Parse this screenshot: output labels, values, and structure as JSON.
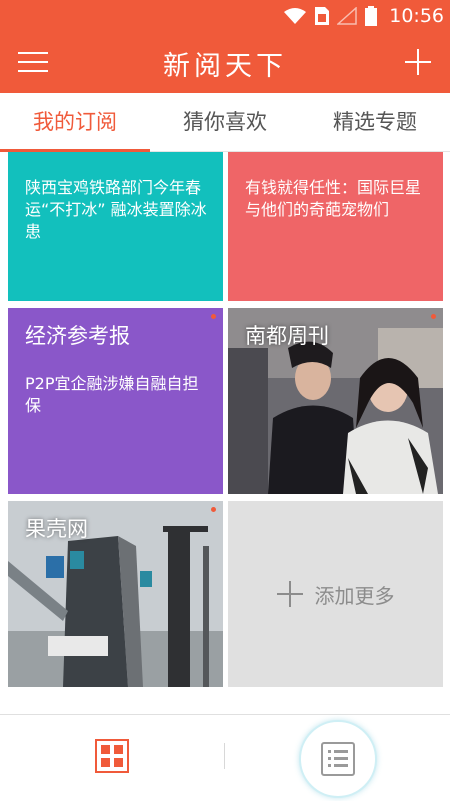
{
  "status_bar": {
    "time": "10:56"
  },
  "header": {
    "title": "新阅天下"
  },
  "tabs": [
    {
      "label": "我的订阅",
      "active": true
    },
    {
      "label": "猜你喜欢",
      "active": false
    },
    {
      "label": "精选专题",
      "active": false
    }
  ],
  "tiles": [
    {
      "kind": "headline",
      "color": "#12c0bd",
      "text": "陕西宝鸡铁路部门今年春运“不打冰” 融冰装置除冰患"
    },
    {
      "kind": "headline",
      "color": "#ef6567",
      "text": "有钱就得任性：国际巨星与他们的奇葩宠物们"
    },
    {
      "kind": "source",
      "color": "#8a57c9",
      "name": "经济参考报",
      "text": "P2P宜企融涉嫌自融自担保",
      "unread_dot": true
    },
    {
      "kind": "source_image",
      "name": "南都周刊",
      "unread_dot": true
    },
    {
      "kind": "source_image",
      "name": "果壳网",
      "unread_dot": true
    },
    {
      "kind": "add",
      "label": "添加更多"
    }
  ],
  "colors": {
    "accent": "#f05a3a",
    "tab_inactive": "#555555",
    "add_tile_bg": "#e0e0e0"
  },
  "icons": {
    "menu": "hamburger-menu-icon",
    "add": "plus-icon",
    "bottom_left": "grid-icon",
    "bottom_right": "list-icon"
  }
}
